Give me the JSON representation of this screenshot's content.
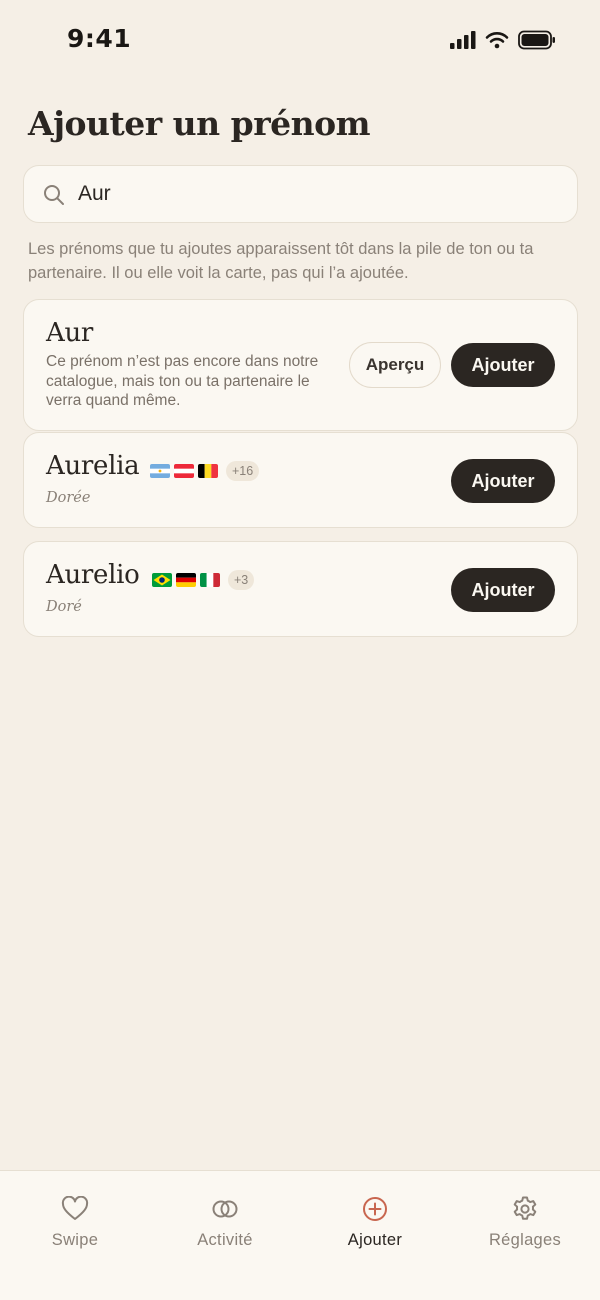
{
  "status_bar": {
    "time": "9:41"
  },
  "page": {
    "title": "Ajouter un prénom"
  },
  "search": {
    "value": "Aur",
    "placeholder": ""
  },
  "helper_text": "Les prénoms que tu ajoutes apparaissent tôt dans la pile de ton ou ta partenaire. Il ou elle voit la carte, pas qui l’a ajoutée.",
  "custom_card": {
    "name": "Aur",
    "description": "Ce prénom n’est pas encore dans notre catalogue, mais ton ou ta partenaire le verra quand même.",
    "preview_label": "Aperçu",
    "add_label": "Ajouter"
  },
  "results": [
    {
      "name": "Aurelia",
      "meaning": "Dorée",
      "flags": [
        "argentina",
        "austria",
        "belgium"
      ],
      "more": "+16",
      "add_label": "Ajouter"
    },
    {
      "name": "Aurelio",
      "meaning": "Doré",
      "flags": [
        "brazil",
        "germany",
        "italy"
      ],
      "more": "+3",
      "add_label": "Ajouter"
    }
  ],
  "tabs": [
    {
      "label": "Swipe",
      "icon": "heart-icon",
      "active": false
    },
    {
      "label": "Activité",
      "icon": "rings-icon",
      "active": false
    },
    {
      "label": "Ajouter",
      "icon": "plus-circle-icon",
      "active": true
    },
    {
      "label": "Réglages",
      "icon": "gear-icon",
      "active": false
    }
  ],
  "colors": {
    "background": "#f5efe6",
    "card": "#fbf8f2",
    "primary": "#2b2622",
    "accent": "#c8664f"
  }
}
